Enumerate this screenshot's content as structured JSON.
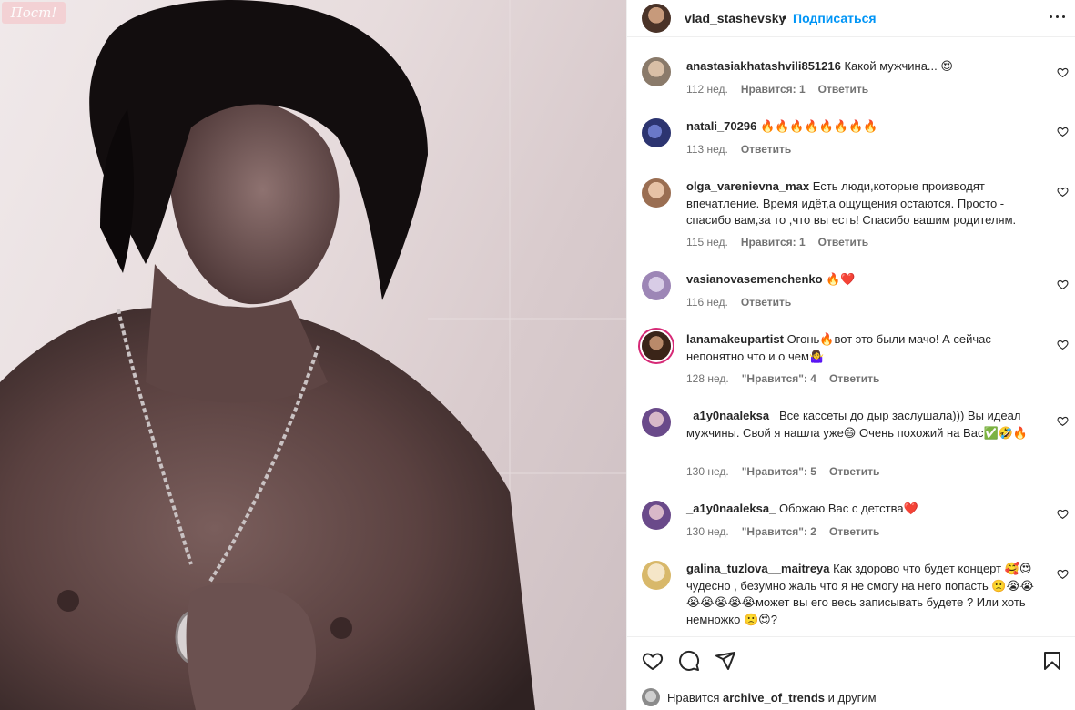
{
  "photo": {
    "watermark": "Пост!"
  },
  "header": {
    "username": "vlad_stashevsky",
    "separator": "•",
    "follow_label": "Подписаться"
  },
  "comments": [
    {
      "user": "anastasiakhatashvili851216",
      "text": "Какой мужчина... 😍",
      "time": "112 нед.",
      "likes": "Нравится: 1",
      "reply": "Ответить",
      "avatar_color": "#8a7a6a"
    },
    {
      "user": "natali_70296",
      "text": "🔥🔥🔥🔥🔥🔥🔥🔥",
      "time": "113 нед.",
      "likes": "",
      "reply": "Ответить",
      "avatar_color": "#3a4a8a"
    },
    {
      "user": "olga_varenievna_max",
      "text": "Есть люди,которые производят впечатление. Время идёт,а ощущения остаются. Просто - спасибо вам,за то ,что вы есть! Спасибо вашим родителям.",
      "time": "115 нед.",
      "likes": "Нравится: 1",
      "reply": "Ответить",
      "avatar_color": "#c9a48a"
    },
    {
      "user": "vasianovasemenchenko",
      "text": "🔥❤️",
      "time": "116 нед.",
      "likes": "",
      "reply": "Ответить",
      "avatar_color": "#b7a3c6"
    },
    {
      "user": "lanamakeupartist",
      "text": "Огонь🔥вот это были мачо! А сейчас непонятно что и о чем🤷‍♀️",
      "time": "128 нед.",
      "likes": "\"Нравится\": 4",
      "reply": "Ответить",
      "avatar_color": "#5a3a2a"
    },
    {
      "user": "_a1y0naaleksa_",
      "text": "Все кассеты до дыр заслушала))) Вы идеал мужчины. Свой я нашла уже😄 Очень похожий на Вас✅🤣🔥",
      "time": "130 нед.",
      "likes": "\"Нравится\": 5",
      "reply": "Ответить",
      "avatar_color": "#7a5a9a"
    },
    {
      "user": "_a1y0naaleksa_",
      "text": "Обожаю Вас с детства❤️",
      "time": "130 нед.",
      "likes": "\"Нравится\": 2",
      "reply": "Ответить",
      "avatar_color": "#7a5a9a"
    },
    {
      "user": "galina_tuzlova__maitreya",
      "text": "Как здорово что будет концерт 🥰😍чудесно , безумно жаль что я не смогу на него попасть 🙁😭😭😭😭😭😭😭может вы его весь записывать будете ? Или хоть немножко 🙁😍?",
      "time": "",
      "likes": "",
      "reply": "",
      "avatar_color": "#e8d4a8"
    }
  ],
  "footer": {
    "likes_prefix": "Нравится",
    "likes_user": "archive_of_trends",
    "likes_suffix": "и другим"
  },
  "colors": {
    "link": "#0095f6",
    "text": "#262626",
    "muted": "#737373",
    "story_ring": "#d62976"
  }
}
